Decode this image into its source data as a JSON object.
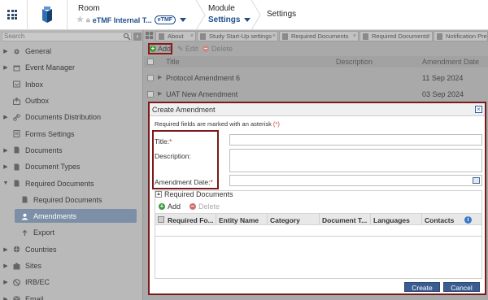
{
  "header": {
    "room_label": "Room",
    "room_name": "eTMF Internal T...",
    "room_badge": "eTMF",
    "module_label": "Module",
    "module_name": "Settings",
    "page_title": "Settings"
  },
  "sidebar": {
    "search_placeholder": "Search",
    "items": [
      {
        "label": "General",
        "icon": "gear-icon",
        "arrow": "▶"
      },
      {
        "label": "Event Manager",
        "icon": "calendar-icon",
        "arrow": "▶"
      },
      {
        "label": "Inbox",
        "icon": "inbox-icon",
        "arrow": ""
      },
      {
        "label": "Outbox",
        "icon": "outbox-icon",
        "arrow": ""
      },
      {
        "label": "Documents Distribution",
        "icon": "link-icon",
        "arrow": "▶"
      },
      {
        "label": "Forms Settings",
        "icon": "form-icon",
        "arrow": ""
      },
      {
        "label": "Documents",
        "icon": "document-icon",
        "arrow": "▶"
      },
      {
        "label": "Document Types",
        "icon": "document-type-icon",
        "arrow": "▶"
      },
      {
        "label": "Required Documents",
        "icon": "required-documents-icon",
        "arrow": "▼"
      },
      {
        "label": "Required Documents",
        "icon": "required-documents-icon",
        "arrow": "",
        "child": true
      },
      {
        "label": "Amendments",
        "icon": "user-icon",
        "arrow": "",
        "child": true,
        "active": true
      },
      {
        "label": "Export",
        "icon": "export-icon",
        "arrow": "",
        "child": true
      },
      {
        "label": "Countries",
        "icon": "globe-icon",
        "arrow": "▶"
      },
      {
        "label": "Sites",
        "icon": "sites-icon",
        "arrow": "▶"
      },
      {
        "label": "IRB/EC",
        "icon": "irb-icon",
        "arrow": "▶"
      },
      {
        "label": "Email",
        "icon": "email-icon",
        "arrow": "▶"
      }
    ]
  },
  "tabs": [
    "About",
    "Study Start-Up settings",
    "Required Documents",
    "Required Documents",
    "Notification Prefe"
  ],
  "toolbar": {
    "add": "Add",
    "edit": "Edit",
    "delete": "Delete"
  },
  "grid": {
    "columns": [
      "Title",
      "Description",
      "Amendment Date"
    ],
    "rows": [
      {
        "title": "Protocol Amendment 6",
        "description": "",
        "date": "11 Sep 2024"
      },
      {
        "title": "UAT New Amendment",
        "description": "",
        "date": "03 Sep 2024"
      }
    ]
  },
  "modal": {
    "title": "Create Amendment",
    "required_note": "Required fields are marked with an asterisk",
    "required_note_ast": "(*)",
    "title_label": "Title:",
    "description_label": "Description:",
    "date_label": "Amendment Date:",
    "asterisk": "*",
    "reqdocs_title": "Required Documents",
    "reqdocs_add": "Add",
    "reqdocs_delete": "Delete",
    "reqdocs_columns": [
      "Required Fo...",
      "Entity Name",
      "Category",
      "Document T...",
      "Languages",
      "Contacts"
    ],
    "create": "Create",
    "cancel": "Cancel"
  },
  "colors": {
    "accent": "#1f4e8c",
    "highlight_border": "#7a1a1a",
    "button": "#3b5c91"
  }
}
